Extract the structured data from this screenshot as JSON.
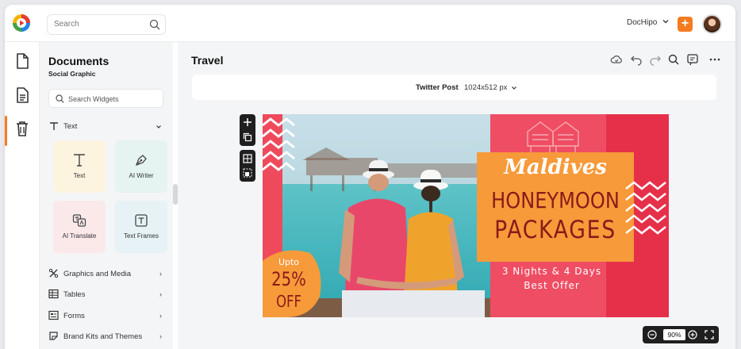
{
  "search": {
    "placeholder": "Search"
  },
  "header": {
    "user_name": "DocHipo",
    "add_label": "+"
  },
  "panel": {
    "title": "Documents",
    "subtitle": "Social Graphic",
    "widget_search_placeholder": "Search Widgets",
    "text_section": "Text",
    "cards": [
      {
        "label": "Text",
        "icon": "text-icon",
        "color": "#fdf4e0"
      },
      {
        "label": "AI Writer",
        "icon": "pen-nib-icon",
        "color": "#e6f4f1"
      },
      {
        "label": "AI Translate",
        "icon": "translate-icon",
        "color": "#fbe9ea"
      },
      {
        "label": "Text Frames",
        "icon": "text-frame-icon",
        "color": "#e6f2f6"
      }
    ],
    "sections": [
      {
        "label": "Graphics and Media",
        "icon": "shapes-icon"
      },
      {
        "label": "Tables",
        "icon": "table-icon"
      },
      {
        "label": "Forms",
        "icon": "form-icon"
      },
      {
        "label": "Brand Kits and Themes",
        "icon": "brand-kit-icon"
      }
    ]
  },
  "main": {
    "doc_title": "Travel",
    "size_type": "Twitter Post",
    "size_dims": "1024x512 px",
    "zoom": "90%"
  },
  "design": {
    "title_script": "Maldives",
    "title_line1": "HONEYMOON",
    "title_line2": "PACKAGES",
    "offer_line1": "3 Nights & 4 Days",
    "offer_line2": "Best Offer",
    "badge_upto": "Upto",
    "badge_pct": "25%",
    "badge_off": "OFF"
  },
  "colors": {
    "accent": "#f47b20",
    "design_red": "#ee4a5c",
    "design_orange": "#f79a3a",
    "title_maroon": "#8b1a1a"
  }
}
